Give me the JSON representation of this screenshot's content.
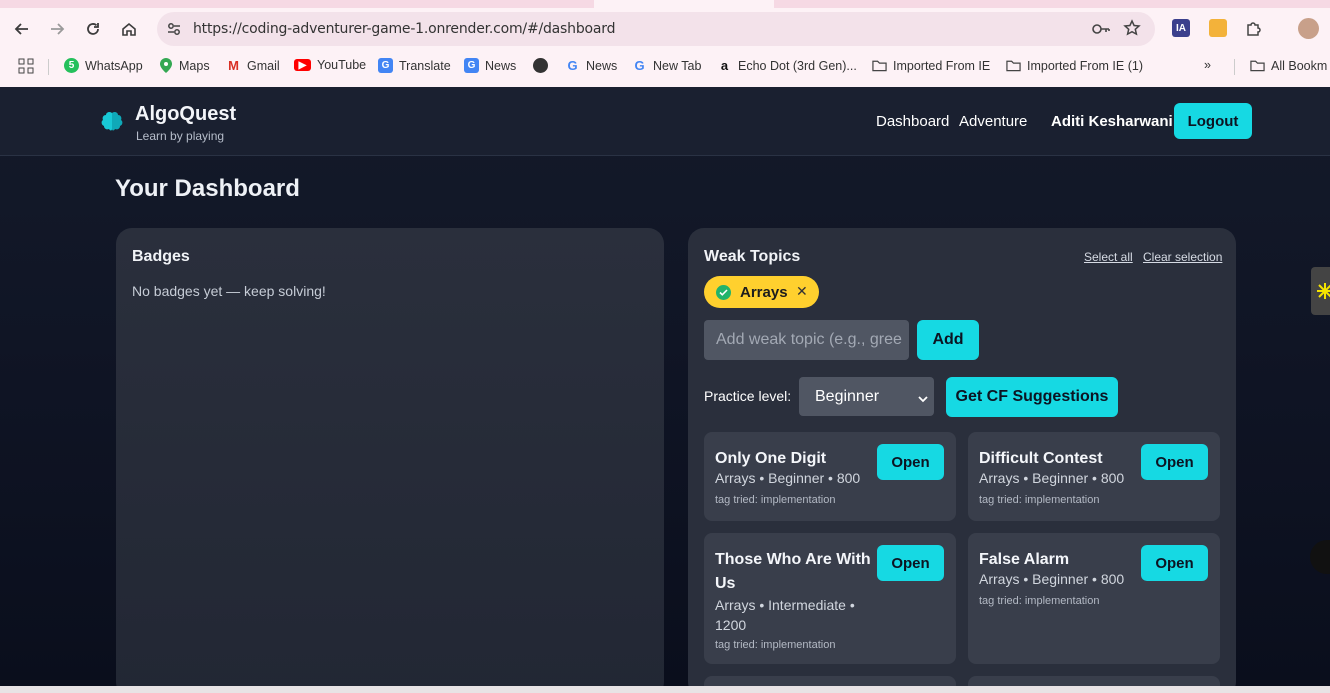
{
  "browser": {
    "url": "https://coding-adventurer-game-1.onrender.com/#/dashboard",
    "bookmarks": [
      "WhatsApp",
      "Maps",
      "Gmail",
      "YouTube",
      "Translate",
      "News",
      "News",
      "New Tab",
      "Echo Dot (3rd Gen)...",
      "Imported From IE",
      "Imported From IE (1)",
      "All Bookm"
    ],
    "whatsapp_badge": "5"
  },
  "app": {
    "brand": "AlgoQuest",
    "tagline": "Learn by playing",
    "nav": [
      "Dashboard",
      "Adventure"
    ],
    "user": "Aditi Kesharwani",
    "logout": "Logout"
  },
  "page": {
    "title": "Your Dashboard"
  },
  "badges": {
    "title": "Badges",
    "empty": "No badges yet — keep solving!"
  },
  "weak_topics": {
    "title": "Weak Topics",
    "select_all": "Select all",
    "clear_selection": "Clear selection",
    "chips": [
      "Arrays"
    ],
    "input_placeholder": "Add weak topic (e.g., gree",
    "add_label": "Add",
    "level_label": "Practice level:",
    "level_value": "Beginner",
    "suggest_label": "Get CF Suggestions"
  },
  "problems": [
    {
      "name": "Only One Digit",
      "meta": "Arrays • Beginner • 800",
      "tag": "tag tried: implementation",
      "open": "Open"
    },
    {
      "name": "Difficult Contest",
      "meta": "Arrays • Beginner • 800",
      "tag": "tag tried: implementation",
      "open": "Open"
    },
    {
      "name": "Those Who Are With Us",
      "meta": "Arrays • Intermediate • 1200",
      "tag": "tag tried: implementation",
      "open": "Open"
    },
    {
      "name": "False Alarm",
      "meta": "Arrays • Beginner • 800",
      "tag": "tag tried: implementation",
      "open": "Open"
    }
  ],
  "colors": {
    "accent": "#16d9e3",
    "chip": "#ffd02e",
    "card": "#2a2f3c",
    "problem_card": "#393e4b"
  }
}
